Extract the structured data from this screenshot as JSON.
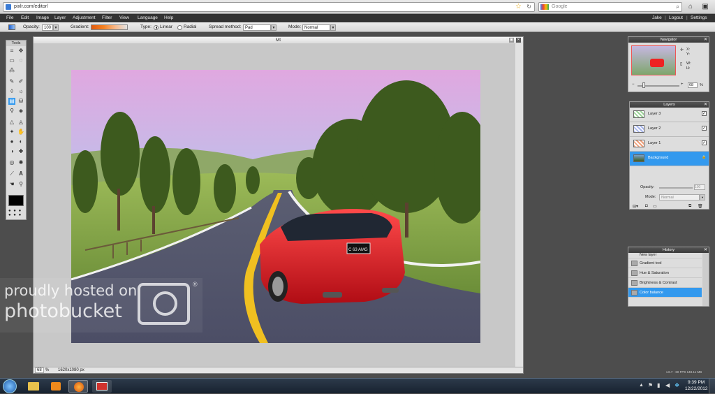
{
  "browser": {
    "url": "pixlr.com/editor/",
    "search_placeholder": "Google",
    "home_icon": "home-icon",
    "colors": {
      "accent": "#3399ee"
    }
  },
  "menubar": {
    "items": [
      "File",
      "Edit",
      "Image",
      "Layer",
      "Adjustment",
      "Filter",
      "View",
      "Language",
      "Help"
    ],
    "user": "Jake",
    "logout": "Logout",
    "settings": "Settings"
  },
  "options": {
    "opacity_label": "Opacity:",
    "opacity_value": "100",
    "gradient_label": "Gradient:",
    "type_label": "Type:",
    "type_linear": "Linear",
    "type_radial": "Radial",
    "spread_label": "Spread method:",
    "spread_value": "Pad",
    "mode_label": "Mode:",
    "mode_value": "Normal"
  },
  "tools": {
    "title": "Tools"
  },
  "document": {
    "title": "Mt",
    "zoom": "68",
    "zoom_unit": "%",
    "size": "1620x1080 px",
    "plate": "C 63 AMG"
  },
  "navigator": {
    "title": "Navigator",
    "x_label": "X:",
    "y_label": "Y:",
    "w_label": "W:",
    "h_label": "H:",
    "zoom": "68",
    "zoom_unit": "%"
  },
  "layers": {
    "title": "Layers",
    "items": [
      {
        "name": "Layer 3",
        "checked": "✓"
      },
      {
        "name": "Layer 2",
        "checked": "✓"
      },
      {
        "name": "Layer 1",
        "checked": "✓"
      },
      {
        "name": "Background",
        "checked": "🔒"
      }
    ],
    "opacity_label": "Opacity:",
    "opacity_value": "100",
    "mode_label": "Mode:",
    "mode_value": "Normal"
  },
  "history": {
    "title": "History",
    "items": [
      "New layer",
      "Gradient tool",
      "Hue & Saturation",
      "Brightness & Contrast",
      "Color balance"
    ]
  },
  "footer": {
    "version": "v.6.7 - 60 FPS 148.11 MB"
  },
  "watermark": {
    "line1": "proudly hosted on",
    "line2": "photobucket"
  },
  "taskbar": {
    "time": "9:39 PM",
    "date": "12/22/2012"
  }
}
